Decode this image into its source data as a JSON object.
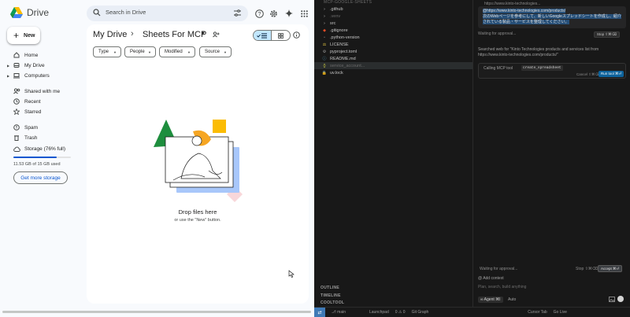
{
  "drive": {
    "app_name": "Drive",
    "search_placeholder": "Search in Drive",
    "new_label": "New",
    "nav": [
      {
        "label": "Home",
        "icon": "home-icon"
      },
      {
        "label": "My Drive",
        "icon": "my-drive-icon"
      },
      {
        "label": "Computers",
        "icon": "computers-icon"
      },
      {
        "label": "Shared with me",
        "icon": "shared-icon"
      },
      {
        "label": "Recent",
        "icon": "clock-icon"
      },
      {
        "label": "Starred",
        "icon": "star-icon"
      },
      {
        "label": "Spam",
        "icon": "spam-icon"
      },
      {
        "label": "Trash",
        "icon": "trash-icon"
      },
      {
        "label": "Storage (76% full)",
        "icon": "cloud-icon"
      }
    ],
    "storage_used_fraction": 0.76,
    "storage_text": "11.53 GB of 15 GB used",
    "get_more_storage": "Get more storage",
    "breadcrumb": {
      "root": "My Drive",
      "separator": "›",
      "current": "Sheets For MCP"
    },
    "filters": [
      "Type",
      "People",
      "Modified",
      "Source"
    ],
    "empty_title": "Drop files here",
    "empty_subtitle": "or use the \"New\" button.",
    "colors": {
      "accent": "#0b57d0",
      "selected": "#c2e7ff",
      "background": "#f8fafd"
    }
  },
  "editor": {
    "explorer_header": "MCP-GOOGLE-SHEETS",
    "files": [
      {
        "name": ".github",
        "icon": "chevron-right-icon",
        "color": "#c5c5c5"
      },
      {
        "name": ".venv",
        "icon": "chevron-right-icon",
        "color": "#6b6b6b"
      },
      {
        "name": "src",
        "icon": "chevron-right-icon",
        "color": "#c5c5c5"
      },
      {
        "name": ".gitignore",
        "icon": "git-icon",
        "color": "#c5c5c5"
      },
      {
        "name": ".python-version",
        "icon": "file-icon",
        "color": "#c5c5c5"
      },
      {
        "name": "LICENSE",
        "icon": "license-icon",
        "color": "#c5c5c5"
      },
      {
        "name": "pyproject.toml",
        "icon": "gear-icon",
        "color": "#c5c5c5"
      },
      {
        "name": "README.md",
        "icon": "info-icon",
        "color": "#c5c5c5"
      },
      {
        "name": "service_account...",
        "icon": "json-icon",
        "color": "#6b6b6b"
      },
      {
        "name": "uv.lock",
        "icon": "lock-icon",
        "color": "#c5c5c5"
      }
    ],
    "panels": [
      "OUTLINE",
      "TIMELINE",
      "COOLTOOL"
    ],
    "status": {
      "branch": "main",
      "sync": "Launchpad",
      "problems": "0 ⚠ 0",
      "git_graph": "Git Graph",
      "cursor_tab": "Cursor Tab",
      "go_live": "Go Live"
    }
  },
  "chat": {
    "url_line": "https://www.kinto-technologies...",
    "user_message_url": "@https://www.kinto-technologies.com/products/",
    "user_message_text": "次のWebページを参考にして、新しいGoogleスプレッドシートを作成し、紹介されている製品・サービスを整理してください。",
    "waiting_label": "Waiting for approval...",
    "stop_label": "Stop ⇧⌘⌫",
    "searched_text": "Searched web for \"Kinto Technologies products and services list from https://www.kinto-technologies.com/products/\"",
    "tool_label": "Calling MCP tool",
    "tool_name": "create_spreadsheet",
    "cancel_label": "Cancel ⇧⌘⌫",
    "run_label": "Run tool ⌘⏎",
    "bottom_wait": "Waiting for approval...",
    "bottom_stop": "Stop ⇧⌘⌫",
    "accept_label": "Accept ⌘⏎",
    "add_context": "@ Add context",
    "input_placeholder": "Plan, search, build anything",
    "agent_mode": "∞ Agent ⌘I",
    "model": "Auto"
  }
}
